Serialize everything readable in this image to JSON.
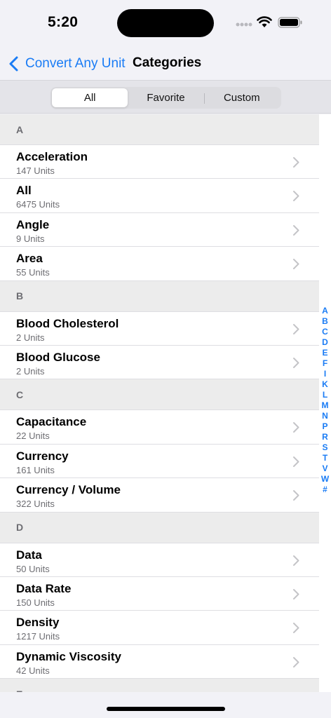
{
  "status": {
    "time": "5:20"
  },
  "nav": {
    "back_label": "Convert Any Unit",
    "title": "Categories"
  },
  "segments": [
    "All",
    "Favorite",
    "Custom"
  ],
  "sections": [
    {
      "letter": "A",
      "rows": [
        {
          "title": "Acceleration",
          "subtitle": "147 Units"
        },
        {
          "title": "All",
          "subtitle": "6475 Units"
        },
        {
          "title": "Angle",
          "subtitle": "9 Units"
        },
        {
          "title": "Area",
          "subtitle": "55 Units"
        }
      ]
    },
    {
      "letter": "B",
      "rows": [
        {
          "title": "Blood Cholesterol",
          "subtitle": "2 Units"
        },
        {
          "title": "Blood Glucose",
          "subtitle": "2 Units"
        }
      ]
    },
    {
      "letter": "C",
      "rows": [
        {
          "title": "Capacitance",
          "subtitle": "22 Units"
        },
        {
          "title": "Currency",
          "subtitle": "161 Units"
        },
        {
          "title": "Currency / Volume",
          "subtitle": "322 Units"
        }
      ]
    },
    {
      "letter": "D",
      "rows": [
        {
          "title": "Data",
          "subtitle": "50 Units"
        },
        {
          "title": "Data Rate",
          "subtitle": "150 Units"
        },
        {
          "title": "Density",
          "subtitle": "1217 Units"
        },
        {
          "title": "Dynamic Viscosity",
          "subtitle": "42 Units"
        }
      ]
    },
    {
      "letter": "E",
      "rows": []
    }
  ],
  "index_letters": [
    "A",
    "B",
    "C",
    "D",
    "E",
    "F",
    "I",
    "K",
    "L",
    "M",
    "N",
    "P",
    "R",
    "S",
    "T",
    "V",
    "W",
    "#"
  ],
  "colors": {
    "accent": "#1a7cf5"
  }
}
